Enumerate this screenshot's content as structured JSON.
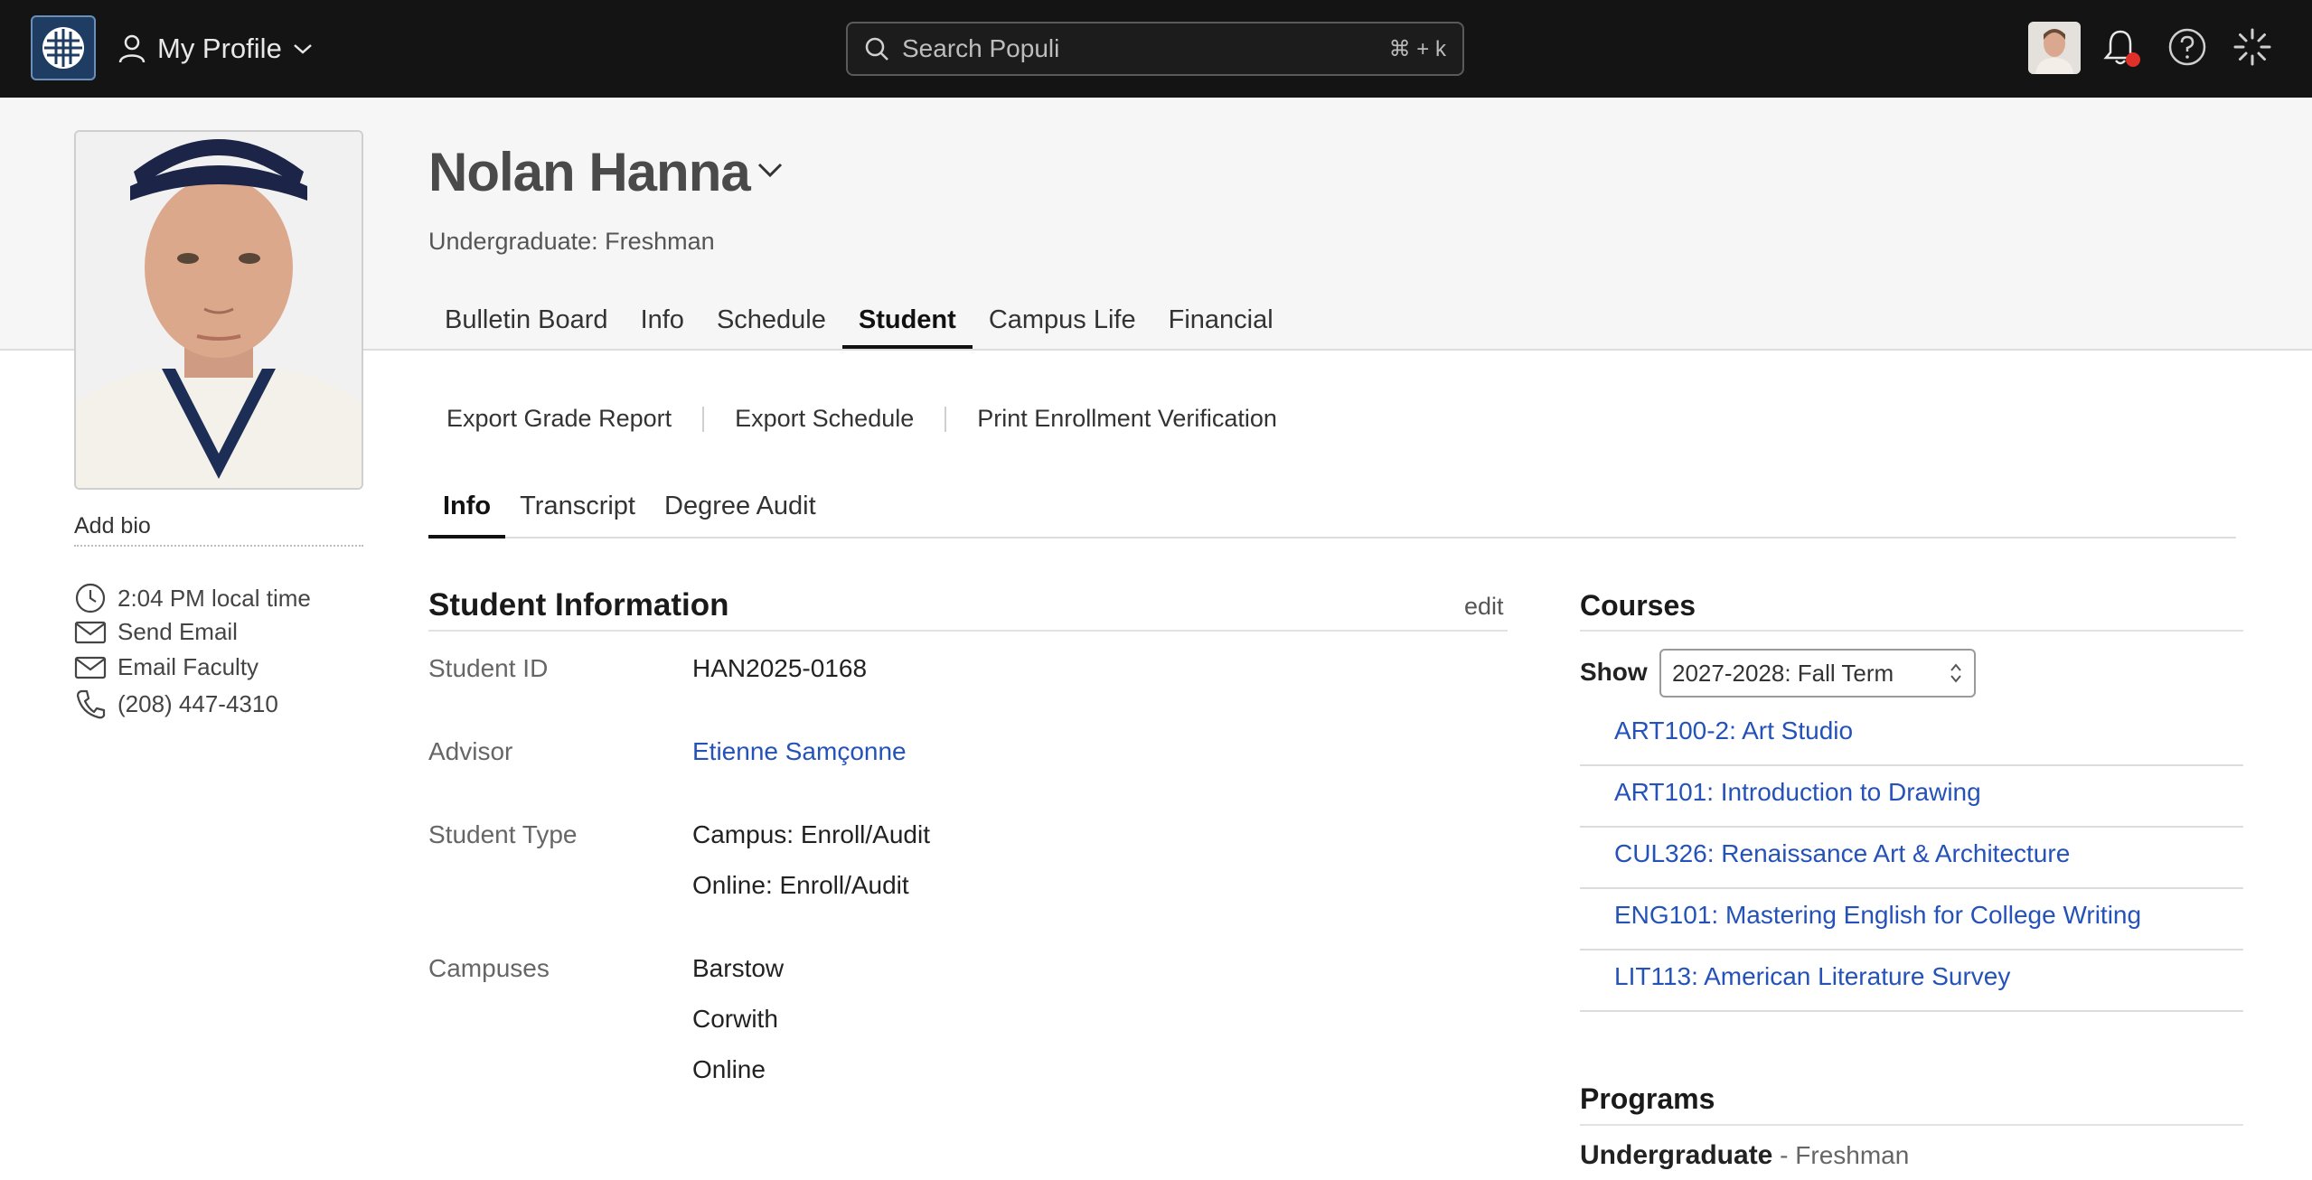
{
  "topbar": {
    "profile_label": "My Profile",
    "search_placeholder": "Search Populi",
    "search_shortcut": "⌘ + k",
    "icons": [
      "populi-logo-icon",
      "user-icon",
      "chevron-down-icon",
      "search-icon",
      "bell-icon",
      "help-icon",
      "loading-spinner-icon"
    ]
  },
  "person": {
    "name": "Nolan Hanna",
    "subtitle": "Undergraduate: Freshman",
    "add_bio": "Add bio",
    "local_time": "2:04 PM local time",
    "send_email": "Send Email",
    "email_faculty": "Email Faculty",
    "phone": "(208) 447-4310"
  },
  "main_tabs": [
    {
      "label": "Bulletin Board",
      "active": false
    },
    {
      "label": "Info",
      "active": false
    },
    {
      "label": "Schedule",
      "active": false
    },
    {
      "label": "Student",
      "active": true
    },
    {
      "label": "Campus Life",
      "active": false
    },
    {
      "label": "Financial",
      "active": false
    }
  ],
  "actions": [
    "Export Grade Report",
    "Export Schedule",
    "Print Enrollment Verification"
  ],
  "sub_tabs": [
    {
      "label": "Info",
      "active": true
    },
    {
      "label": "Transcript",
      "active": false
    },
    {
      "label": "Degree Audit",
      "active": false
    }
  ],
  "student_info": {
    "title": "Student Information",
    "edit_label": "edit",
    "student_id_label": "Student ID",
    "student_id": "HAN2025-0168",
    "advisor_label": "Advisor",
    "advisor": "Etienne Samçonne",
    "student_type_label": "Student Type",
    "student_types": [
      "Campus: Enroll/Audit",
      "Online: Enroll/Audit"
    ],
    "campuses_label": "Campuses",
    "campuses": [
      "Barstow",
      "Corwith",
      "Online"
    ]
  },
  "courses": {
    "title": "Courses",
    "show_label": "Show",
    "term": "2027-2028: Fall Term",
    "items": [
      "ART100-2: Art Studio",
      "ART101: Introduction to Drawing",
      "CUL326: Renaissance Art & Architecture",
      "ENG101: Mastering English for College Writing",
      "LIT113: American Literature Survey"
    ]
  },
  "programs": {
    "title": "Programs",
    "name": "Undergraduate",
    "separator": " - ",
    "level": "Freshman"
  },
  "colors": {
    "topbar_bg": "#141414",
    "link": "#2452b8",
    "notification_dot": "#e0302a",
    "header_bg": "#f6f6f6"
  }
}
